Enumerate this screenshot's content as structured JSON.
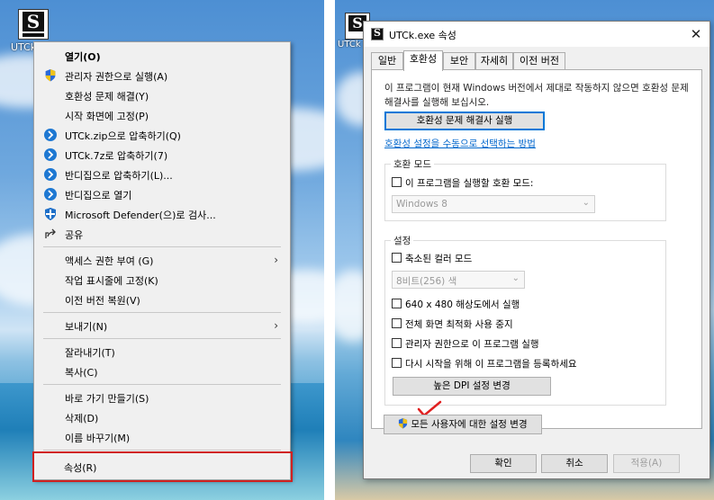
{
  "desktop_icon": {
    "label": "UTCk"
  },
  "context_menu": {
    "groups": [
      [
        {
          "label": "열기(O)",
          "bold": true,
          "icon": ""
        },
        {
          "label": "관리자 권한으로 실행(A)",
          "icon": "uac-shield-icon"
        },
        {
          "label": "호환성 문제 해결(Y)",
          "icon": ""
        },
        {
          "label": "시작 화면에 고정(P)",
          "icon": ""
        },
        {
          "label": "UTCk.zip으로 압축하기(Q)",
          "icon": "bandizip-icon"
        },
        {
          "label": "UTCk.7z로 압축하기(7)",
          "icon": "bandizip-icon"
        },
        {
          "label": "반디집으로 압축하기(L)...",
          "icon": "bandizip-icon"
        },
        {
          "label": "반디집으로 열기",
          "icon": "bandizip-icon"
        },
        {
          "label": "Microsoft Defender(으)로 검사...",
          "icon": "defender-icon"
        },
        {
          "label": "공유",
          "icon": "share-icon"
        }
      ],
      [
        {
          "label": "액세스 권한 부여 (G)",
          "submenu": true
        },
        {
          "label": "작업 표시줄에 고정(K)"
        },
        {
          "label": "이전 버전 복원(V)"
        }
      ],
      [
        {
          "label": "보내기(N)",
          "submenu": true
        }
      ],
      [
        {
          "label": "잘라내기(T)"
        },
        {
          "label": "복사(C)"
        }
      ],
      [
        {
          "label": "바로 가기 만들기(S)"
        },
        {
          "label": "삭제(D)"
        },
        {
          "label": "이름 바꾸기(M)"
        }
      ],
      [
        {
          "label": "속성(R)",
          "highlighted": true
        }
      ]
    ]
  },
  "dialog": {
    "title": "UTCk.exe 속성",
    "tabs": [
      "일반",
      "호환성",
      "보안",
      "자세히",
      "이전 버전"
    ],
    "active_tab": "호환성",
    "intro": "이 프로그램이 현재 Windows 버전에서 제대로 작동하지 않으면 호환성 문제 해결사를 실행해 보십시오.",
    "troubleshooter_button": "호환성 문제 해결사 실행",
    "manual_link": "호환성 설정을 수동으로 선택하는 방법",
    "compat_mode": {
      "title": "호환 모드",
      "checkbox_label": "이 프로그램을 실행할 호환 모드:",
      "checked": false,
      "os_value": "Windows 8"
    },
    "settings": {
      "title": "설정",
      "reduced_color": {
        "label": "축소된 컬러 모드",
        "checked": false
      },
      "color_value": "8비트(256) 색",
      "res_640": {
        "label": "640 x 480 해상도에서 실행",
        "checked": false
      },
      "fullscreen_opt": {
        "label": "전체 화면 최적화 사용 중지",
        "checked": false
      },
      "run_as_admin": {
        "label": "관리자 권한으로 이 프로그램 실행",
        "checked": false
      },
      "register_restart": {
        "label": "다시 시작을 위해 이 프로그램을 등록하세요",
        "checked": false
      },
      "dpi_button": "높은 DPI 설정 변경"
    },
    "all_users_button": "모든 사용자에 대한 설정 변경",
    "ok_button": "확인",
    "cancel_button": "취소",
    "apply_button": "적용(A)"
  },
  "colors": {
    "highlight_box": "#d02020",
    "link": "#0066cc",
    "focus": "#0078d7"
  }
}
